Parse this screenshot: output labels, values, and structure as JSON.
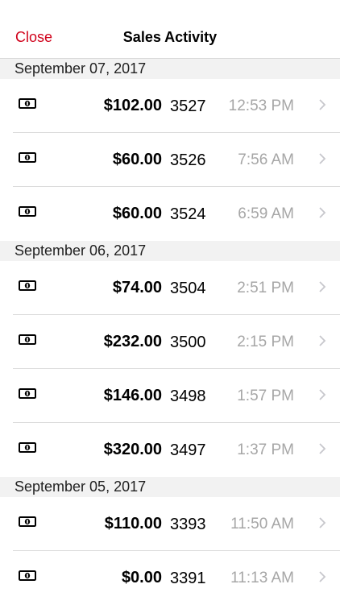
{
  "navbar": {
    "close_label": "Close",
    "title": "Sales Activity"
  },
  "colors": {
    "accent": "#d0021b",
    "section_bg": "#f2f2f2",
    "time_gray": "#a6a6a6",
    "chevron_gray": "#c7c7cc"
  },
  "icons": {
    "row_icon": "cash-icon",
    "row_disclosure": "chevron-right-icon"
  },
  "sections": [
    {
      "date": "September 07, 2017",
      "rows": [
        {
          "amount": "$102.00",
          "ticket": "3527",
          "time": "12:53 PM"
        },
        {
          "amount": "$60.00",
          "ticket": "3526",
          "time": "7:56 AM"
        },
        {
          "amount": "$60.00",
          "ticket": "3524",
          "time": "6:59 AM"
        }
      ]
    },
    {
      "date": "September 06, 2017",
      "rows": [
        {
          "amount": "$74.00",
          "ticket": "3504",
          "time": "2:51 PM"
        },
        {
          "amount": "$232.00",
          "ticket": "3500",
          "time": "2:15 PM"
        },
        {
          "amount": "$146.00",
          "ticket": "3498",
          "time": "1:57 PM"
        },
        {
          "amount": "$320.00",
          "ticket": "3497",
          "time": "1:37 PM"
        }
      ]
    },
    {
      "date": "September 05, 2017",
      "rows": [
        {
          "amount": "$110.00",
          "ticket": "3393",
          "time": "11:50 AM"
        },
        {
          "amount": "$0.00",
          "ticket": "3391",
          "time": "11:13 AM"
        }
      ]
    }
  ]
}
